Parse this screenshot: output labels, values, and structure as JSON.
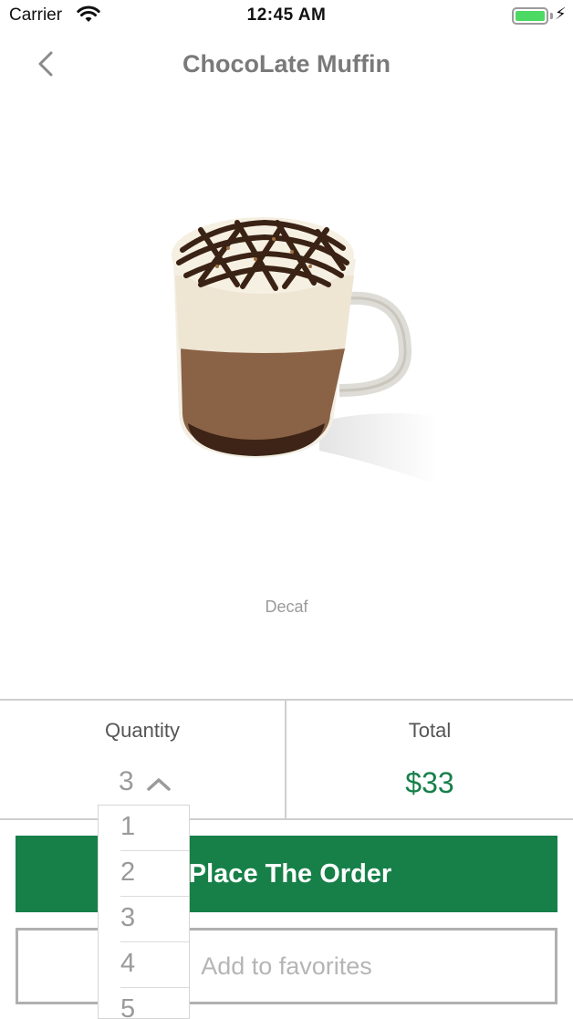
{
  "status_bar": {
    "carrier": "Carrier",
    "time": "12:45 AM",
    "battery_level": 1.0,
    "battery_color": "#4cd964"
  },
  "nav": {
    "back_icon": "chevron-left-icon",
    "title": "ChocoLate Muffin"
  },
  "product": {
    "image_subject": "hot chocolate mug with whipped cream and chocolate drizzle",
    "caption": "Decaf"
  },
  "quantity": {
    "label": "Quantity",
    "selected": "3",
    "chevron_icon": "chevron-up-icon",
    "options": [
      "1",
      "2",
      "3",
      "4",
      "5"
    ]
  },
  "total": {
    "label": "Total",
    "value": "$33",
    "color": "#17804a"
  },
  "actions": {
    "place_order_label": "Place The Order",
    "place_order_color": "#168048",
    "favorites_label": "Add to favorites"
  }
}
